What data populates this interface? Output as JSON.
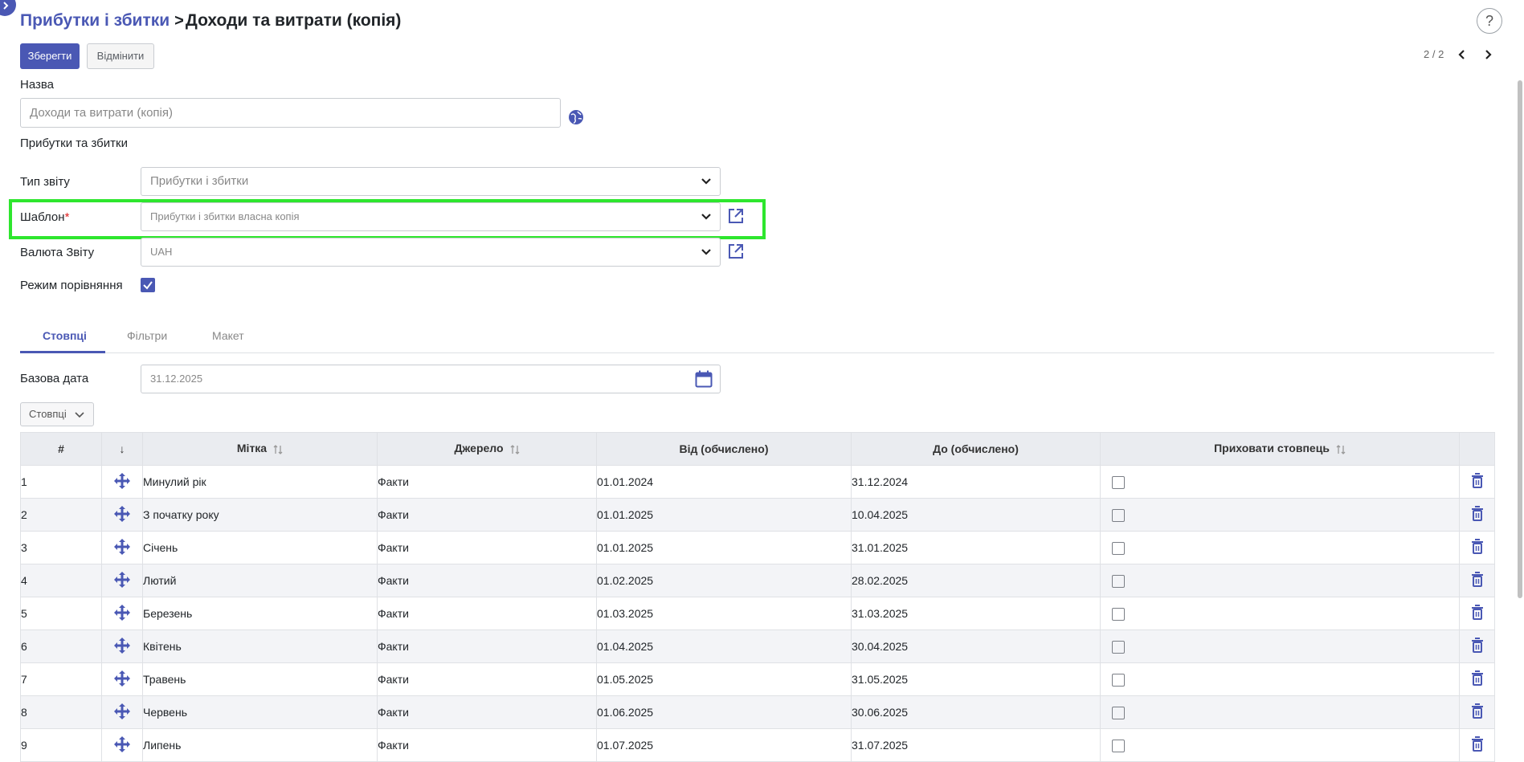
{
  "header": {
    "breadcrumb_parent": "Прибутки і збитки",
    "breadcrumb_separator": ">",
    "breadcrumb_current": "Доходи та витрати (копія)",
    "help_label": "?"
  },
  "toolbar": {
    "save_label": "Зберегти",
    "cancel_label": "Відмінити",
    "pager_text": "2 / 2"
  },
  "form": {
    "name_label": "Назва",
    "name_value": "Доходи та витрати (копія)",
    "section_title": "Прибутки та збитки",
    "report_type_label": "Тип звіту",
    "report_type_value": "Прибутки і збитки",
    "template_label": "Шаблон",
    "template_required_mark": "*",
    "template_value": "Прибутки і збитки власна копія",
    "currency_label": "Валюта Звіту",
    "currency_value": "UAH",
    "comparison_label": "Режим порівняння",
    "comparison_checked": true
  },
  "tabs": [
    {
      "label": "Стовпці",
      "active": true
    },
    {
      "label": "Фільтри",
      "active": false
    },
    {
      "label": "Макет",
      "active": false
    }
  ],
  "columns_tab": {
    "base_date_label": "Базова дата",
    "base_date_value": "31.12.2025",
    "columns_dropdown_label": "Стовпці"
  },
  "table": {
    "headers": {
      "num": "#",
      "drag": "↓",
      "label": "Мітка",
      "source": "Джерело",
      "from": "Від (обчислено)",
      "to": "До (обчислено)",
      "hide": "Приховати стовпець"
    },
    "rows": [
      {
        "num": "1",
        "label": "Минулий рік",
        "source": "Факти",
        "from": "01.01.2024",
        "to": "31.12.2024",
        "hidden": false
      },
      {
        "num": "2",
        "label": "З початку року",
        "source": "Факти",
        "from": "01.01.2025",
        "to": "10.04.2025",
        "hidden": false
      },
      {
        "num": "3",
        "label": "Січень",
        "source": "Факти",
        "from": "01.01.2025",
        "to": "31.01.2025",
        "hidden": false
      },
      {
        "num": "4",
        "label": "Лютий",
        "source": "Факти",
        "from": "01.02.2025",
        "to": "28.02.2025",
        "hidden": false
      },
      {
        "num": "5",
        "label": "Березень",
        "source": "Факти",
        "from": "01.03.2025",
        "to": "31.03.2025",
        "hidden": false
      },
      {
        "num": "6",
        "label": "Квітень",
        "source": "Факти",
        "from": "01.04.2025",
        "to": "30.04.2025",
        "hidden": false
      },
      {
        "num": "7",
        "label": "Травень",
        "source": "Факти",
        "from": "01.05.2025",
        "to": "31.05.2025",
        "hidden": false
      },
      {
        "num": "8",
        "label": "Червень",
        "source": "Факти",
        "from": "01.06.2025",
        "to": "30.06.2025",
        "hidden": false
      },
      {
        "num": "9",
        "label": "Липень",
        "source": "Факти",
        "from": "01.07.2025",
        "to": "31.07.2025",
        "hidden": false
      }
    ]
  },
  "colors": {
    "accent": "#4a58b4",
    "highlight": "#2ee62e",
    "required": "#e02020"
  },
  "icons": {
    "globe": "globe-icon",
    "external_link": "external-link-icon",
    "calendar": "calendar-icon",
    "drag": "move-icon",
    "delete": "trash-icon"
  }
}
